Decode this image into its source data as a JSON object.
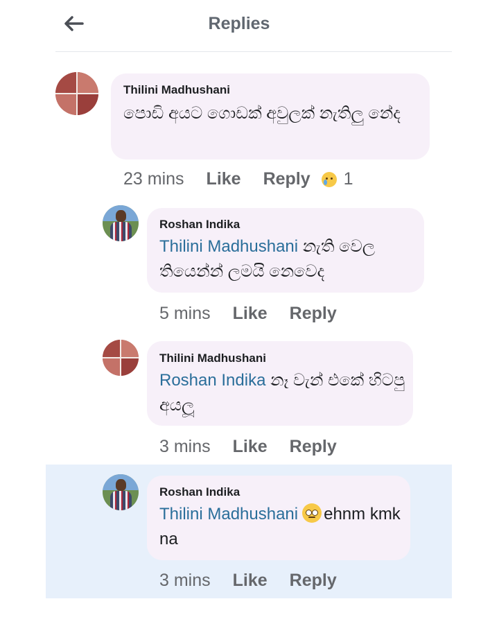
{
  "header": {
    "title": "Replies"
  },
  "comments": [
    {
      "author": "Thilini Madhushani",
      "mention": "",
      "text": "පොඩි අයට ගොඩක් අවුලක් නැතිලු නේද",
      "time": "23 mins",
      "like_label": "Like",
      "reply_label": "Reply",
      "reaction_count": "1",
      "reaction_icon": "sad-tear-emoji"
    },
    {
      "author": "Roshan Indika",
      "mention": "Thilini Madhushani",
      "text": "නැති වෙල තියෙන්න් ලමයි නෙවෙද",
      "time": "5 mins",
      "like_label": "Like",
      "reply_label": "Reply"
    },
    {
      "author": "Thilini Madhushani",
      "mention": "Roshan Indika",
      "text": "නෑ වැන් එකේ හිටපු අයලූ",
      "time": "3 mins",
      "like_label": "Like",
      "reply_label": "Reply"
    },
    {
      "author": "Roshan Indika",
      "mention": "Thilini Madhushani",
      "text_after_emoji": "ehnm kmk na",
      "inline_emoji": "eye-roll-emoji",
      "time": "3 mins",
      "like_label": "Like",
      "reply_label": "Reply",
      "highlighted": true
    }
  ],
  "colors": {
    "mention": "#2a6e9a",
    "bubble": "#f7f0f9",
    "highlight": "#e7f0fb",
    "meta": "#65676b"
  }
}
